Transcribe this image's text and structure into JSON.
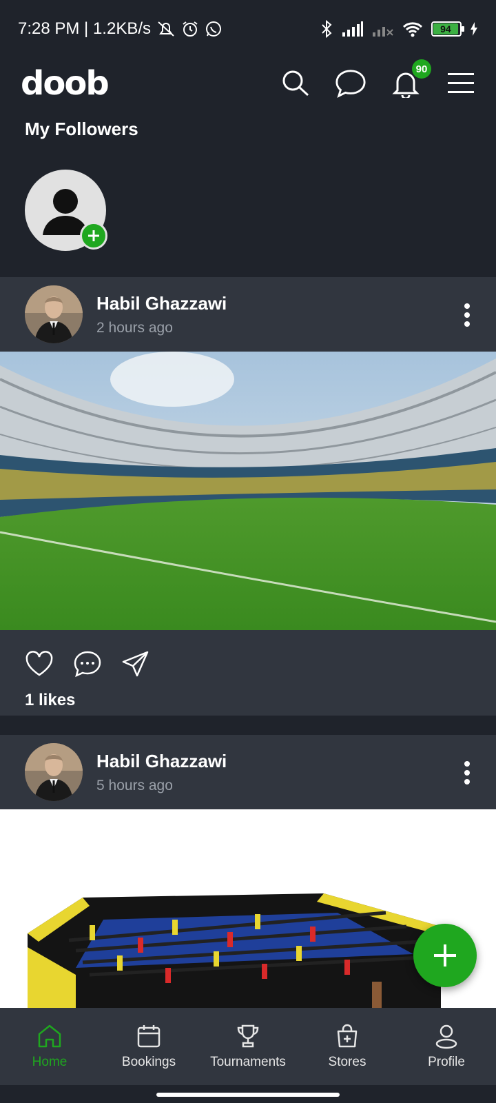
{
  "status_bar": {
    "time_speed": "7:28 PM | 1.2KB/s",
    "battery": "94"
  },
  "header": {
    "logo": "doob",
    "notification_count": "90"
  },
  "followers": {
    "title": "My Followers"
  },
  "posts": [
    {
      "author": "Habil Ghazzawi",
      "time": "2 hours ago",
      "likes": "1 likes"
    },
    {
      "author": "Habil Ghazzawi",
      "time": "5 hours ago"
    }
  ],
  "bottom_nav": [
    {
      "label": "Home",
      "icon": "home-icon",
      "active": true
    },
    {
      "label": "Bookings",
      "icon": "calendar-icon"
    },
    {
      "label": "Tournaments",
      "icon": "trophy-icon"
    },
    {
      "label": "Stores",
      "icon": "store-bag-icon"
    },
    {
      "label": "Profile",
      "icon": "profile-icon"
    }
  ],
  "colors": {
    "background": "#1f232b",
    "card": "#31363f",
    "accent": "#1fa71f"
  }
}
